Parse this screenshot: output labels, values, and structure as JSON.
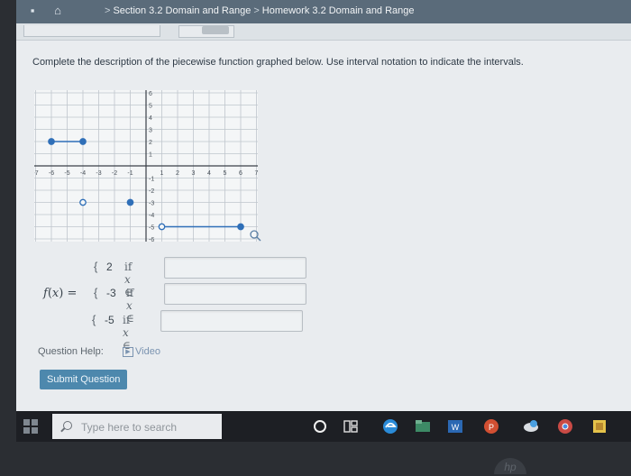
{
  "breadcrumb": {
    "section": "Section 3.2 Domain and Range",
    "separator": ">",
    "homework": "Homework 3.2 Domain and Range"
  },
  "instructions": "Complete the description of the piecewise function graphed below. Use interval notation to indicate the intervals.",
  "graph": {
    "x_ticks": [
      "-7",
      "-6",
      "-5",
      "-4",
      "-3",
      "-2",
      "-1",
      "1",
      "2",
      "3",
      "4",
      "5",
      "6",
      "7"
    ],
    "y_ticks": [
      "6",
      "5",
      "4",
      "3",
      "2",
      "1",
      "-1",
      "-2",
      "-3",
      "-4",
      "-5",
      "-6"
    ],
    "xlim": [
      -7,
      7
    ],
    "ylim": [
      -6,
      6
    ],
    "segments": [
      {
        "x1": -6,
        "x2": -4,
        "y": 2,
        "left": "closed",
        "right": "closed"
      },
      {
        "x1": -4,
        "x2": -1,
        "y": -3,
        "left": "open",
        "right": "closed",
        "show_line": false
      },
      {
        "x1": 1,
        "x2": 6,
        "y": -5,
        "left": "open",
        "right": "closed"
      }
    ],
    "zoom_icon": "magnifier-icon",
    "colors": {
      "segment": "#2f6fb8",
      "grid": "#bfc6cc",
      "axis": "#3a4048"
    }
  },
  "function": {
    "label_f": "f",
    "label_x": "x",
    "label_eq": "=",
    "pieces": [
      {
        "value": "2",
        "if_text": "if",
        "var": "x",
        "in": "∈",
        "answer": ""
      },
      {
        "value": "-3",
        "if_text": "if",
        "var": "x",
        "in": "∈",
        "answer": ""
      },
      {
        "value": "-5",
        "if_text": "if",
        "var": "x",
        "in": "∈",
        "answer": ""
      }
    ],
    "brace": "{"
  },
  "help": {
    "label": "Question Help:",
    "video": "Video",
    "video_icon": "play-icon"
  },
  "submit_label": "Submit Question",
  "taskbar": {
    "search_placeholder": "Type here to search",
    "icons": [
      "windows-start-icon",
      "cortana-circle-icon",
      "task-view-icon",
      "edge-icon",
      "file-explorer-icon",
      "word-icon",
      "powerpoint-icon",
      "weather-icon",
      "chrome-icon",
      "notes-icon"
    ]
  },
  "hardware": {
    "logo": "hp"
  }
}
